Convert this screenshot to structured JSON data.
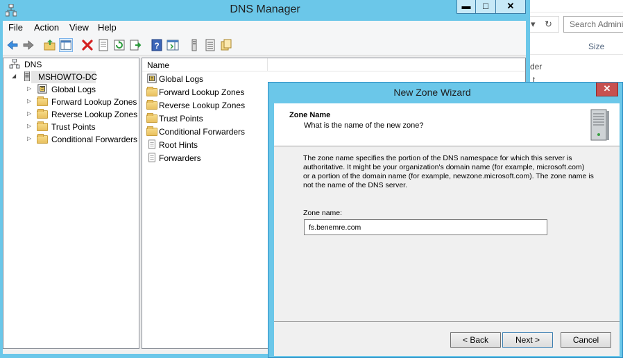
{
  "background_window": {
    "search_placeholder": "Search Admini",
    "size_header": "Size",
    "partial_text_1": "der",
    "partial_text_2": "t"
  },
  "dns_manager": {
    "title": "DNS Manager",
    "window_buttons": {
      "minimize": "▬",
      "maximize": "□",
      "close": "✕"
    },
    "menu": [
      "File",
      "Action",
      "View",
      "Help"
    ],
    "toolbar_icons": [
      "back-icon",
      "forward-icon",
      "up-folder-icon",
      "show-hide-console-tree-icon",
      "delete-icon",
      "properties-icon",
      "refresh-icon",
      "export-list-icon",
      "help-icon",
      "action-pane-icon",
      "server-icon",
      "list-icon",
      "copy-icon"
    ],
    "tree": {
      "root": "DNS",
      "server": "MSHOWTO-DC",
      "children": [
        "Global Logs",
        "Forward Lookup Zones",
        "Reverse Lookup Zones",
        "Trust Points",
        "Conditional Forwarders"
      ]
    },
    "list": {
      "column_name": "Name",
      "items": [
        {
          "label": "Global Logs",
          "icon": "log-icon"
        },
        {
          "label": "Forward Lookup Zones",
          "icon": "folder-icon"
        },
        {
          "label": "Reverse Lookup Zones",
          "icon": "folder-icon"
        },
        {
          "label": "Trust Points",
          "icon": "folder-icon"
        },
        {
          "label": "Conditional Forwarders",
          "icon": "folder-icon"
        },
        {
          "label": "Root Hints",
          "icon": "document-icon"
        },
        {
          "label": "Forwarders",
          "icon": "document-icon"
        }
      ]
    }
  },
  "wizard": {
    "title": "New Zone Wizard",
    "close": "✕",
    "heading": "Zone Name",
    "subheading": "What is the name of the new zone?",
    "description_lines": [
      "The zone name specifies the portion of the DNS namespace for which this server is",
      "authoritative. It might be your organization's domain name (for example,  microsoft.com)",
      "or a portion of the domain name (for example, newzone.microsoft.com). The zone name is",
      "not the name of the DNS server."
    ],
    "zone_label": "Zone name:",
    "zone_value": "fs.benemre.com",
    "back_button": "< Back",
    "next_button": "Next >",
    "cancel_button": "Cancel"
  }
}
